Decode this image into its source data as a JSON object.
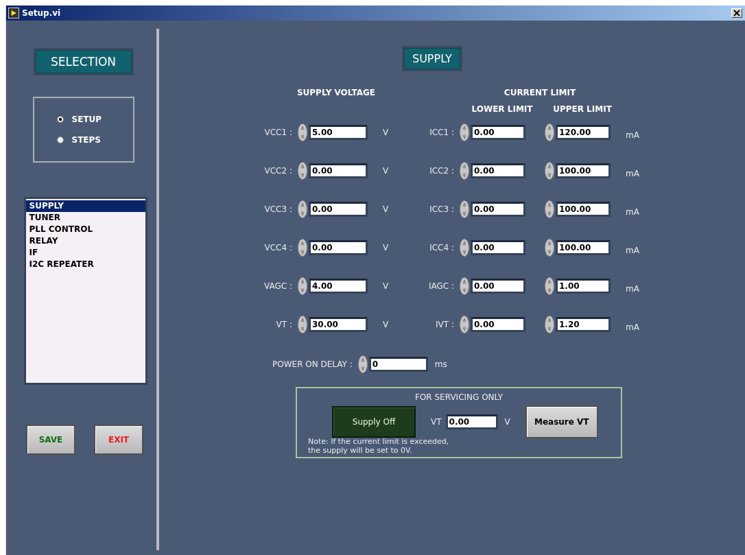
{
  "window": {
    "title": "Setup.vi"
  },
  "sidebar": {
    "heading": "SELECTION",
    "modes": [
      {
        "label": "SETUP",
        "selected": true
      },
      {
        "label": "STEPS",
        "selected": false
      }
    ],
    "items": [
      {
        "label": "SUPPLY",
        "selected": true
      },
      {
        "label": "TUNER",
        "selected": false
      },
      {
        "label": "PLL CONTROL",
        "selected": false
      },
      {
        "label": "RELAY",
        "selected": false
      },
      {
        "label": "IF",
        "selected": false
      },
      {
        "label": "I2C REPEATER",
        "selected": false
      }
    ],
    "buttons": [
      {
        "label": "SAVE",
        "color": "#107010"
      },
      {
        "label": "EXIT",
        "color": "#f01818"
      }
    ]
  },
  "supply": {
    "title": "SUPPLY",
    "voltage_heading": "SUPPLY VOLTAGE",
    "current_heading": "CURRENT LIMIT",
    "lower_heading": "LOWER LIMIT",
    "upper_heading": "UPPER LIMIT",
    "rows": [
      {
        "voltage_label": "VCC1 :",
        "voltage": "5.00",
        "voltage_unit": "V",
        "current_label": "ICC1 :",
        "lower": "0.00",
        "upper": "120.00",
        "current_unit": "mA"
      },
      {
        "voltage_label": "VCC2 :",
        "voltage": "0.00",
        "voltage_unit": "V",
        "current_label": "ICC2 :",
        "lower": "0.00",
        "upper": "100.00",
        "current_unit": "mA"
      },
      {
        "voltage_label": "VCC3 :",
        "voltage": "0.00",
        "voltage_unit": "V",
        "current_label": "ICC3 :",
        "lower": "0.00",
        "upper": "100.00",
        "current_unit": "mA"
      },
      {
        "voltage_label": "VCC4 :",
        "voltage": "0.00",
        "voltage_unit": "V",
        "current_label": "ICC4 :",
        "lower": "0.00",
        "upper": "100.00",
        "current_unit": "mA"
      },
      {
        "voltage_label": "VAGC :",
        "voltage": "4.00",
        "voltage_unit": "V",
        "current_label": "IAGC :",
        "lower": "0.00",
        "upper": "1.00",
        "current_unit": "mA"
      },
      {
        "voltage_label": "VT :",
        "voltage": "30.00",
        "voltage_unit": "V",
        "current_label": "IVT :",
        "lower": "0.00",
        "upper": "1.20",
        "current_unit": "mA"
      }
    ],
    "delay": {
      "label": "POWER ON DELAY :",
      "value": "0",
      "unit": "ms"
    }
  },
  "servicing": {
    "title": "FOR SERVICING ONLY",
    "supply_button": "Supply Off",
    "vt_label": "VT",
    "vt_value": "0.00",
    "vt_unit": "V",
    "measure_button": "Measure VT",
    "note_lines": [
      "Note: If the current limit is exceeded,",
      "the supply will be set to 0V."
    ]
  }
}
